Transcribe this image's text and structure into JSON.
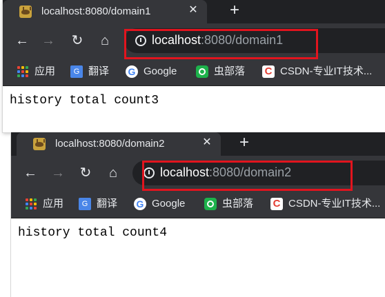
{
  "colors": {
    "tabstrip": "#202124",
    "toolbar": "#35363a",
    "highlight_box": "#e2141e",
    "url_host": "#ffffff",
    "url_path": "#9aa0a6"
  },
  "windows": [
    {
      "tab": {
        "title": "localhost:8080/domain1",
        "close_glyph": "✕",
        "favicon": "tomcat-favicon-icon"
      },
      "new_tab_glyph": "+",
      "nav": {
        "back": "←",
        "forward": "→",
        "reload": "↻",
        "home": "⌂"
      },
      "url": {
        "host": "localhost",
        "rest": ":8080/domain1"
      },
      "bookmarks": [
        {
          "label": "应用",
          "icon": "apps-grid-icon"
        },
        {
          "label": "翻译",
          "icon": "translate-icon"
        },
        {
          "label": "Google",
          "icon": "google-icon"
        },
        {
          "label": "虫部落",
          "icon": "chongbuluo-icon"
        },
        {
          "label": "CSDN-专业IT技术...",
          "icon": "csdn-icon"
        }
      ],
      "page_text": "history total count3"
    },
    {
      "tab": {
        "title": "localhost:8080/domain2",
        "close_glyph": "✕",
        "favicon": "tomcat-favicon-icon"
      },
      "new_tab_glyph": "+",
      "nav": {
        "back": "←",
        "forward": "→",
        "reload": "↻",
        "home": "⌂"
      },
      "url": {
        "host": "localhost",
        "rest": ":8080/domain2"
      },
      "bookmarks": [
        {
          "label": "应用",
          "icon": "apps-grid-icon"
        },
        {
          "label": "翻译",
          "icon": "translate-icon"
        },
        {
          "label": "Google",
          "icon": "google-icon"
        },
        {
          "label": "虫部落",
          "icon": "chongbuluo-icon"
        },
        {
          "label": "CSDN-专业IT技术...",
          "icon": "csdn-icon"
        }
      ],
      "page_text": "history total count4"
    }
  ]
}
